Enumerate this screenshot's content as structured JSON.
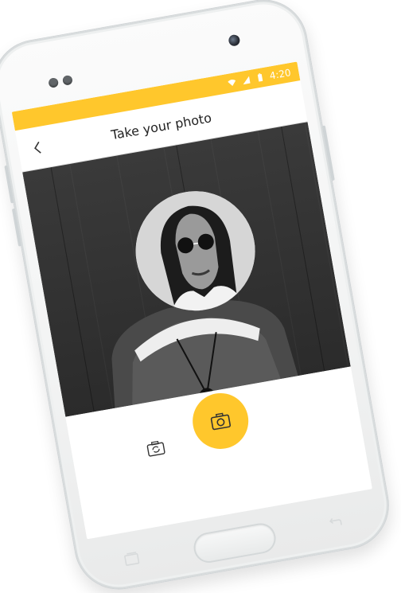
{
  "status_bar": {
    "time": "4:20",
    "background_color": "#FFC72C",
    "icons": [
      "wifi-icon",
      "signal-icon",
      "battery-icon"
    ]
  },
  "header": {
    "title": "Take your photo",
    "back_icon": "chevron-left-icon"
  },
  "camera": {
    "guide_shape": "circle"
  },
  "controls": {
    "switch_camera_icon": "camera-switch-icon",
    "capture_icon": "camera-icon",
    "accent_color": "#FFC72C"
  },
  "device": {
    "hardware_buttons": [
      "recent-apps",
      "home",
      "back"
    ]
  }
}
